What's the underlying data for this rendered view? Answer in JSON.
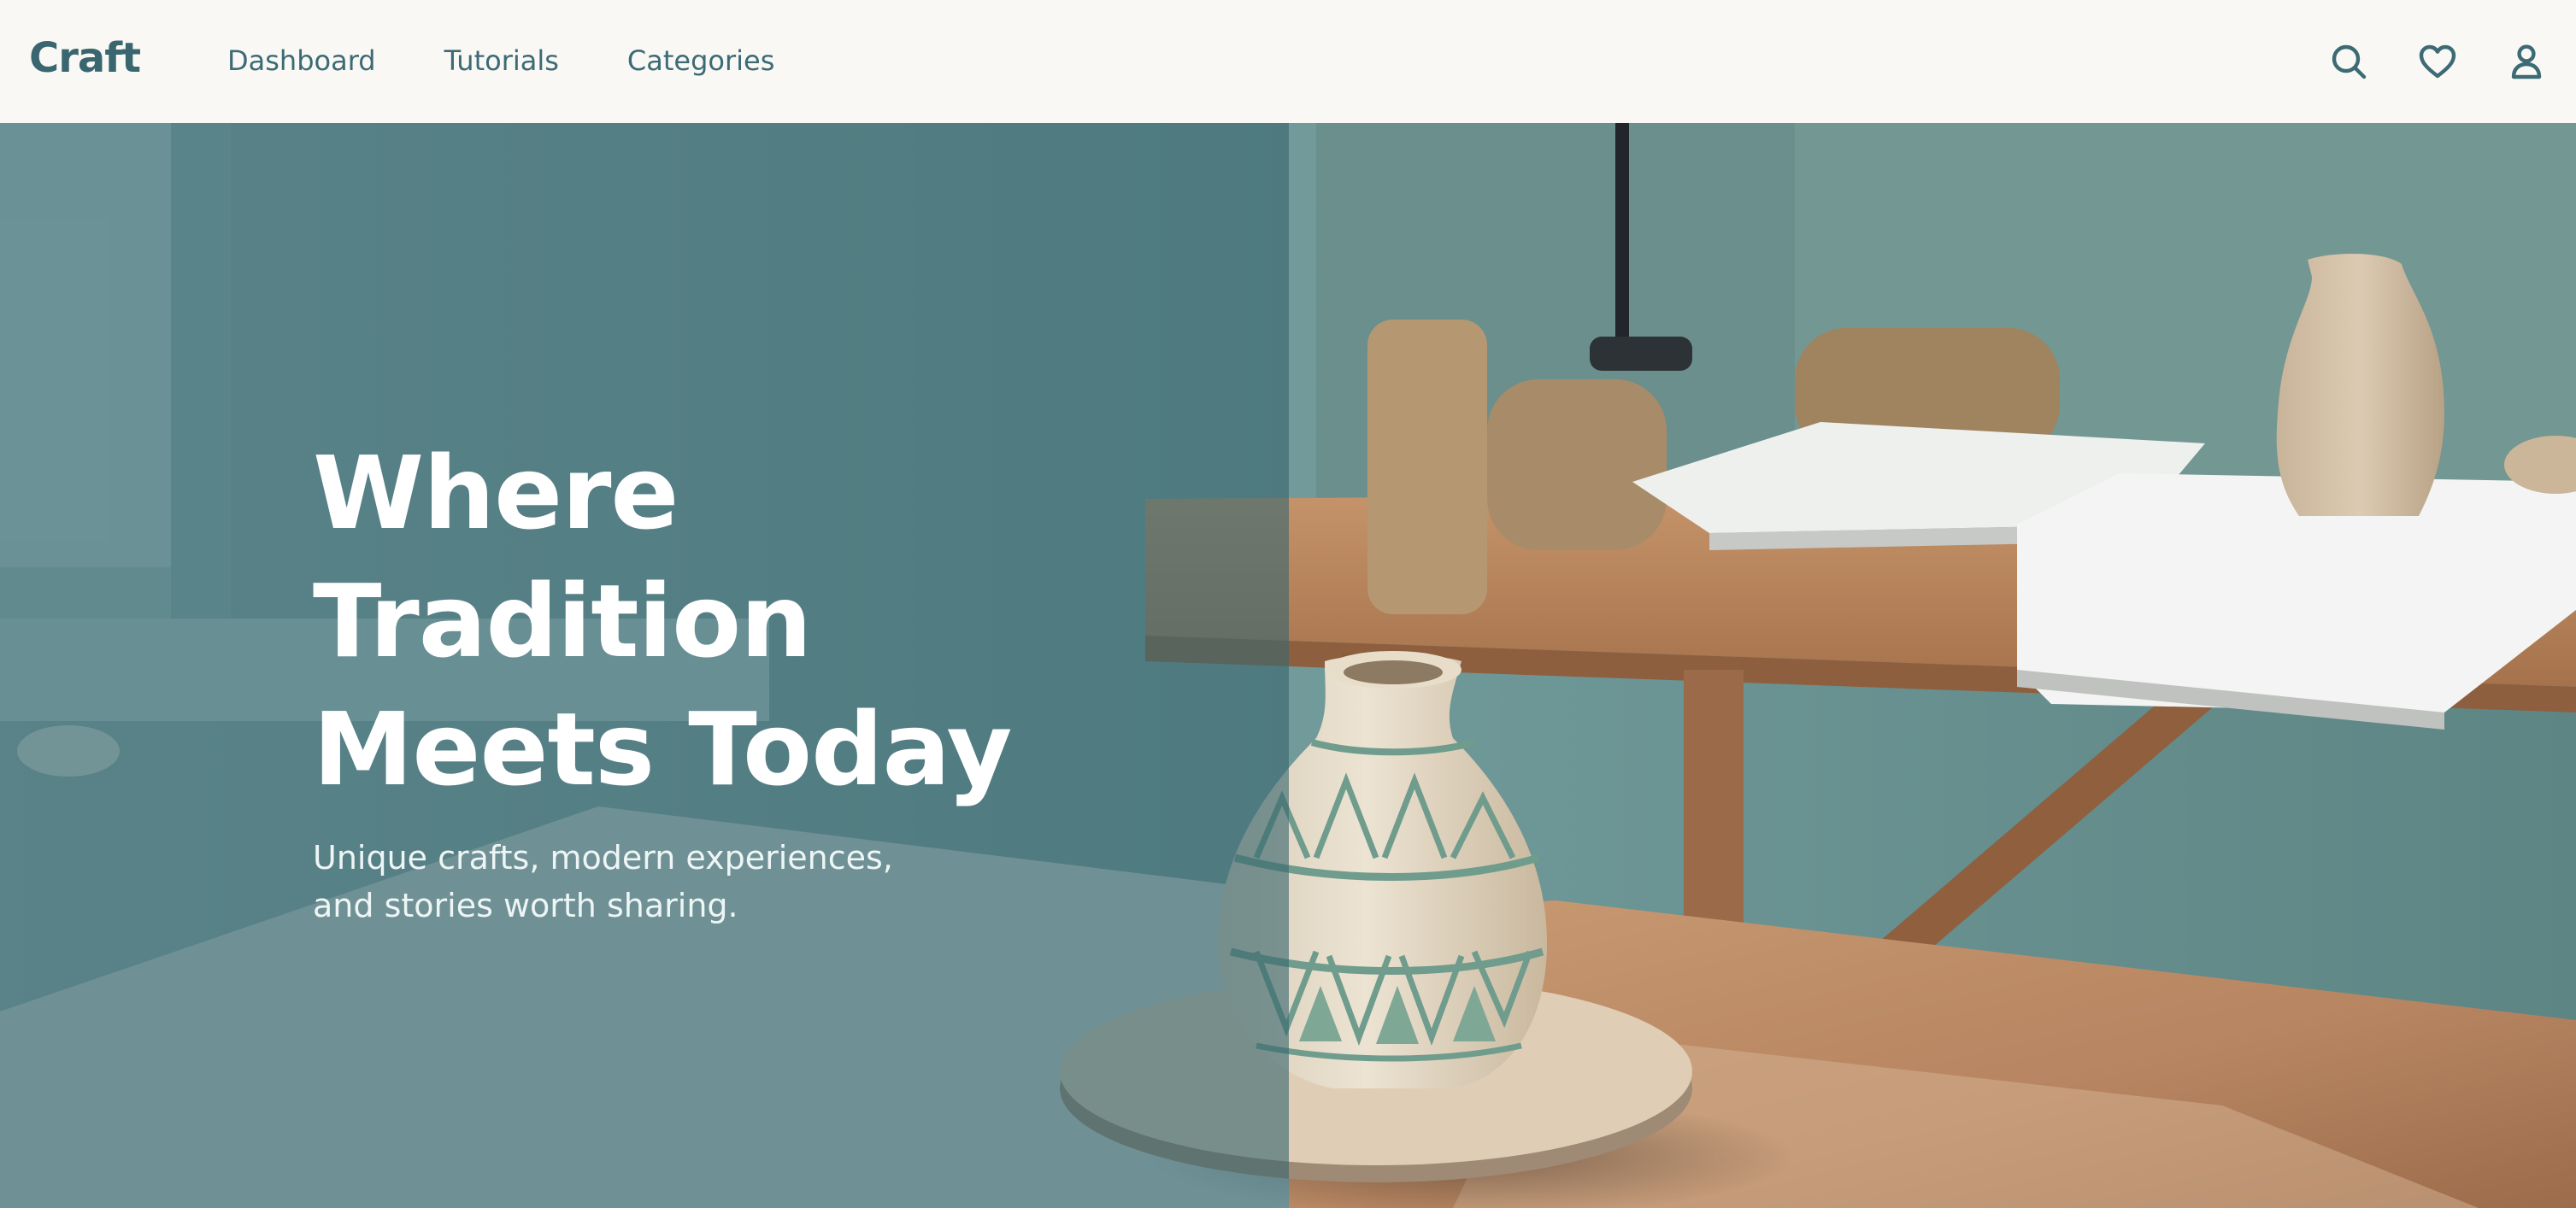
{
  "brand": {
    "name": "Craft"
  },
  "nav": {
    "links": [
      {
        "label": "Dashboard"
      },
      {
        "label": "Tutorials"
      },
      {
        "label": "Categories"
      }
    ],
    "icons": [
      "search-icon",
      "heart-icon",
      "user-icon"
    ]
  },
  "hero": {
    "title_lines": [
      "Where",
      "Tradition",
      "Meets Today"
    ],
    "subtitle": "Unique crafts, modern experiences, and stories worth sharing.",
    "image": "pottery-workshop-photo"
  },
  "colors": {
    "brand": "#3a6670",
    "nav_bg": "#f9f8f4",
    "overlay": "#386870",
    "hero_text": "#ffffff"
  }
}
